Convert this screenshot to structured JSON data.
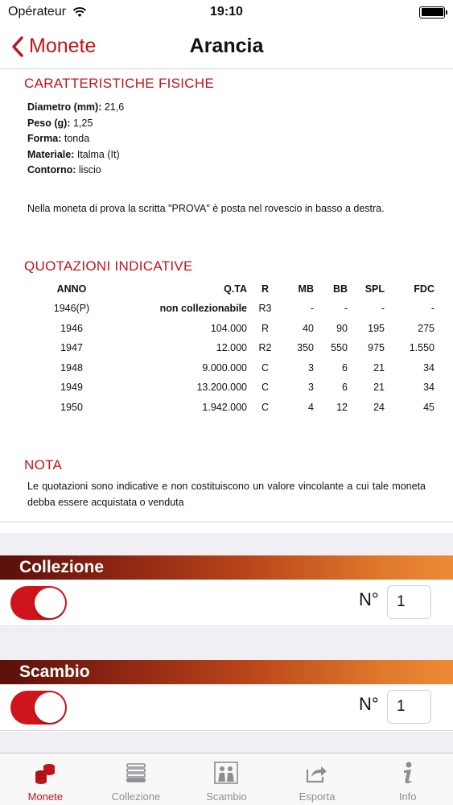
{
  "status_bar": {
    "carrier": "Opérateur",
    "time": "19:10"
  },
  "nav": {
    "back_label": "Monete",
    "title": "Arancia"
  },
  "physical": {
    "title": "CARATTERISTICHE FISICHE",
    "specs": [
      {
        "label": "Diametro (mm):",
        "value": "21,6"
      },
      {
        "label": "Peso (g):",
        "value": "1,25"
      },
      {
        "label": "Forma:",
        "value": "tonda"
      },
      {
        "label": "Materiale:",
        "value": "Italma (It)"
      },
      {
        "label": "Contorno:",
        "value": "liscio"
      }
    ],
    "note": "Nella moneta di prova la scritta \"PROVA\" è posta nel rovescio in basso a destra."
  },
  "quotes": {
    "title": "QUOTAZIONI INDICATIVE",
    "columns": [
      "ANNO",
      "Q.TA",
      "R",
      "MB",
      "BB",
      "SPL",
      "FDC"
    ],
    "rows": [
      [
        "1946(P)",
        "non collezionabile",
        "R3",
        "-",
        "-",
        "-",
        "-"
      ],
      [
        "1946",
        "104.000",
        "R",
        "40",
        "90",
        "195",
        "275"
      ],
      [
        "1947",
        "12.000",
        "R2",
        "350",
        "550",
        "975",
        "1.550"
      ],
      [
        "1948",
        "9.000.000",
        "C",
        "3",
        "6",
        "21",
        "34"
      ],
      [
        "1949",
        "13.200.000",
        "C",
        "3",
        "6",
        "21",
        "34"
      ],
      [
        "1950",
        "1.942.000",
        "C",
        "4",
        "12",
        "24",
        "45"
      ]
    ]
  },
  "note": {
    "title": "NOTA",
    "text": "Le quotazioni sono indicative e non costituiscono un valore vincolante a cui tale moneta debba essere acquistata o venduta"
  },
  "collection": {
    "title": "Collezione",
    "enabled": true,
    "number_label": "N°",
    "number_value": "1"
  },
  "exchange": {
    "title": "Scambio",
    "enabled": true,
    "number_label": "N°",
    "number_value": "1"
  },
  "tabs": [
    {
      "label": "Monete",
      "icon": "coins-icon",
      "active": true
    },
    {
      "label": "Collezione",
      "icon": "stack-icon",
      "active": false
    },
    {
      "label": "Scambio",
      "icon": "exchange-icon",
      "active": false
    },
    {
      "label": "Esporta",
      "icon": "share-icon",
      "active": false
    },
    {
      "label": "Info",
      "icon": "info-icon",
      "active": false
    }
  ],
  "colors": {
    "accent": "#c0141b",
    "toggle_on": "#d0141b",
    "tab_inactive": "#8e8e93"
  }
}
